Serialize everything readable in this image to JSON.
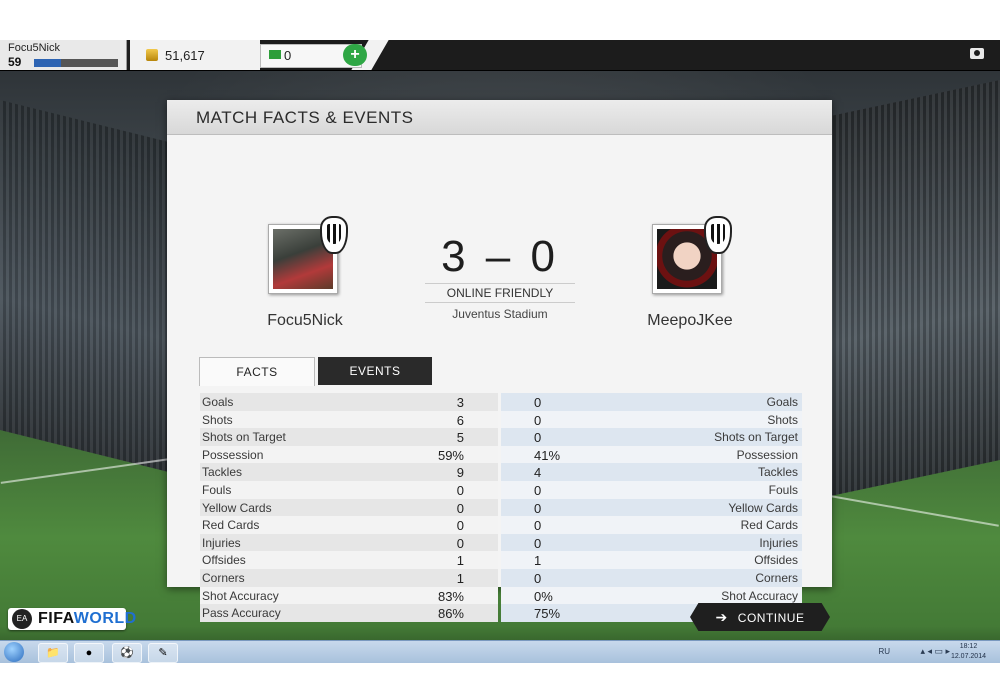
{
  "topbar": {
    "player_name": "Focu5Nick",
    "player_level": "59",
    "xp_progress": 0.32,
    "coins": "51,617",
    "points": "0",
    "plus_label": "+",
    "camera_icon": "camera-icon"
  },
  "panel": {
    "title": "MATCH FACTS & EVENTS",
    "home": {
      "name": "Focu5Nick",
      "crest_icon": "juventus-crest-icon"
    },
    "away": {
      "name": "MeepoJKee",
      "crest_icon": "juventus-crest-icon"
    },
    "score": "3 – 0",
    "match_type": "ONLINE FRIENDLY",
    "stadium": "Juventus Stadium",
    "tabs": [
      {
        "label": "FACTS",
        "active": true
      },
      {
        "label": "EVENTS",
        "active": false
      }
    ],
    "stats": [
      {
        "label": "Goals",
        "home": "3",
        "away": "0"
      },
      {
        "label": "Shots",
        "home": "6",
        "away": "0"
      },
      {
        "label": "Shots on Target",
        "home": "5",
        "away": "0"
      },
      {
        "label": "Possession",
        "home": "59%",
        "away": "41%"
      },
      {
        "label": "Tackles",
        "home": "9",
        "away": "4"
      },
      {
        "label": "Fouls",
        "home": "0",
        "away": "0"
      },
      {
        "label": "Yellow Cards",
        "home": "0",
        "away": "0"
      },
      {
        "label": "Red Cards",
        "home": "0",
        "away": "0"
      },
      {
        "label": "Injuries",
        "home": "0",
        "away": "0"
      },
      {
        "label": "Offsides",
        "home": "1",
        "away": "1"
      },
      {
        "label": "Corners",
        "home": "1",
        "away": "0"
      },
      {
        "label": "Shot Accuracy",
        "home": "83%",
        "away": "0%"
      },
      {
        "label": "Pass Accuracy",
        "home": "86%",
        "away": "75%"
      }
    ]
  },
  "footer": {
    "logo_fifa": "FIFA",
    "logo_world": "WORLD",
    "ea_badge": "EA",
    "continue_label": "CONTINUE"
  },
  "taskbar": {
    "lang": "RU",
    "time": "18:12",
    "date": "12.07.2014"
  },
  "colors": {
    "accent_blue": "#2d64b3",
    "plus_green": "#2fa745",
    "panel_bg": "#f4f4f4"
  }
}
